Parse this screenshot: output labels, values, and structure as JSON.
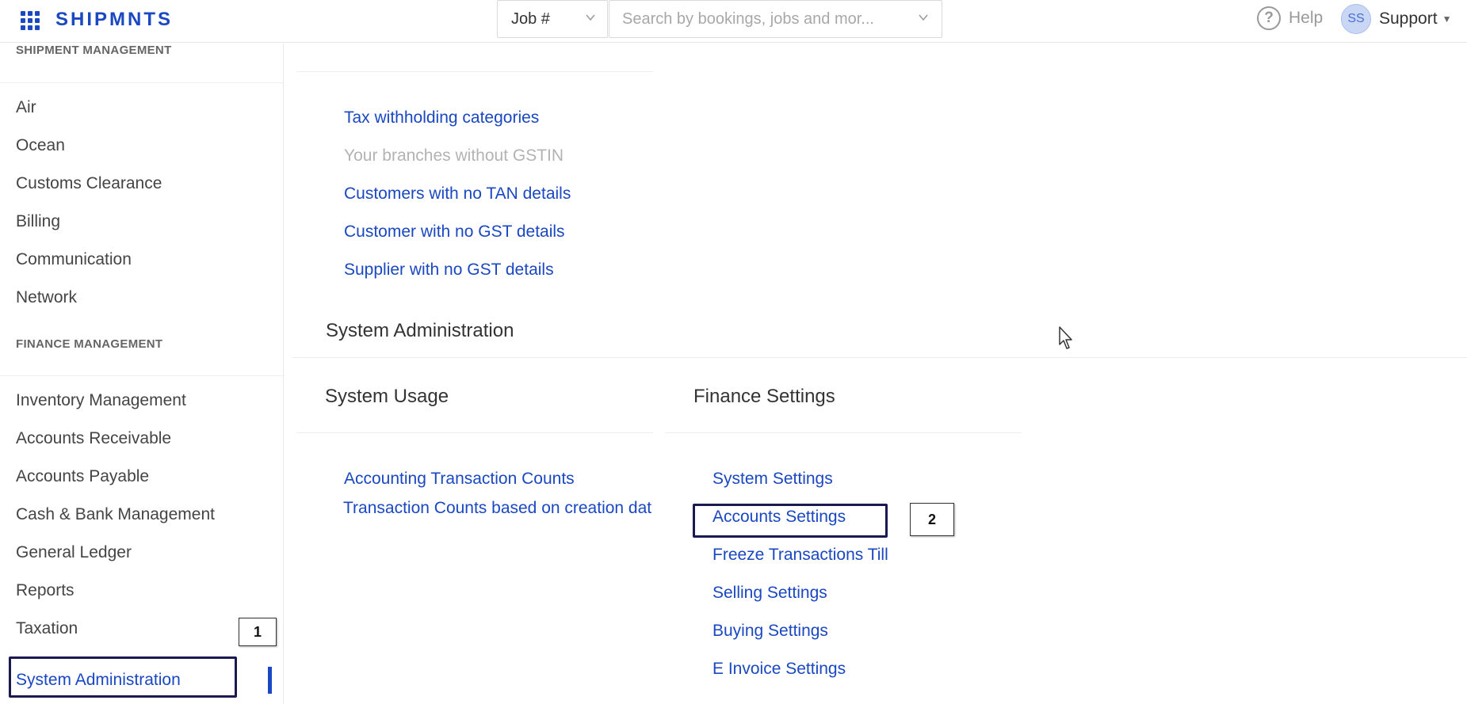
{
  "header": {
    "brand": "SHIPMNTS",
    "job_select_value": "Job #",
    "search_placeholder": "Search by bookings, jobs and mor...",
    "help_label": "Help",
    "user_initials": "SS",
    "user_name": "Support"
  },
  "sidebar": {
    "shipment_heading": "SHIPMENT MANAGEMENT",
    "shipment_items": [
      "Air",
      "Ocean",
      "Customs Clearance",
      "Billing",
      "Communication",
      "Network"
    ],
    "finance_heading": "FINANCE MANAGEMENT",
    "finance_items": [
      "Inventory Management",
      "Accounts Receivable",
      "Accounts Payable",
      "Cash & Bank Management",
      "General Ledger",
      "Reports",
      "Taxation"
    ],
    "active_item": "System Administration"
  },
  "main": {
    "tax_links": [
      {
        "label": "Tax withholding categories",
        "enabled": true
      },
      {
        "label": "Your branches without GSTIN",
        "enabled": false
      },
      {
        "label": "Customers with no TAN details",
        "enabled": true
      },
      {
        "label": "Customer with no GST details",
        "enabled": true
      },
      {
        "label": "Supplier with no GST details",
        "enabled": true
      }
    ],
    "system_admin_title": "System Administration",
    "system_usage": {
      "title": "System Usage",
      "links": [
        "Accounting Transaction Counts",
        "Transaction Counts based on creation date"
      ]
    },
    "finance_settings": {
      "title": "Finance Settings",
      "links": [
        "System Settings",
        "Accounts Settings",
        "Freeze Transactions Till",
        "Selling Settings",
        "Buying Settings",
        "E Invoice Settings"
      ]
    }
  },
  "annotations": {
    "tag_1": "1",
    "tag_2": "2"
  },
  "colors": {
    "brand": "#1a47c2",
    "link": "#1a47c2",
    "disabled": "#b3b3b3",
    "annotation_border": "#1a1a4e"
  }
}
